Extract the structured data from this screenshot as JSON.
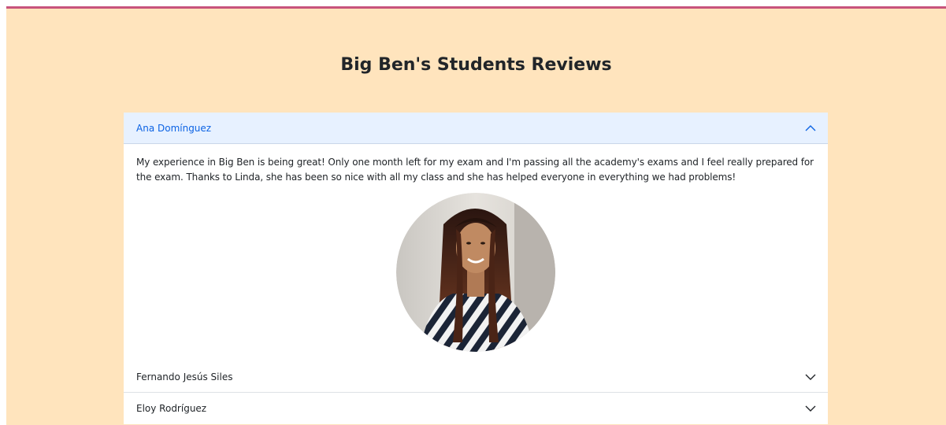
{
  "page": {
    "title": "Big Ben's Students Reviews"
  },
  "colors": {
    "background": "#ffe4bd",
    "accent_line": "#c8537c",
    "active_header_bg": "#e7f1ff",
    "active_header_text": "#0c63e4"
  },
  "reviews": [
    {
      "name": "Ana Domínguez",
      "expanded": true,
      "text": "My experience in Big Ben is being great! Only one month left for my exam and I'm passing all the academy's exams and I feel really prepared for the exam. Thanks to Linda, she has been so nice with all my class and she has helped everyone in everything we had problems!",
      "icon": "chevron-up-icon"
    },
    {
      "name": "Fernando Jesús Siles",
      "expanded": false,
      "icon": "chevron-down-icon"
    },
    {
      "name": "Eloy Rodríguez",
      "expanded": false,
      "icon": "chevron-down-icon"
    }
  ]
}
